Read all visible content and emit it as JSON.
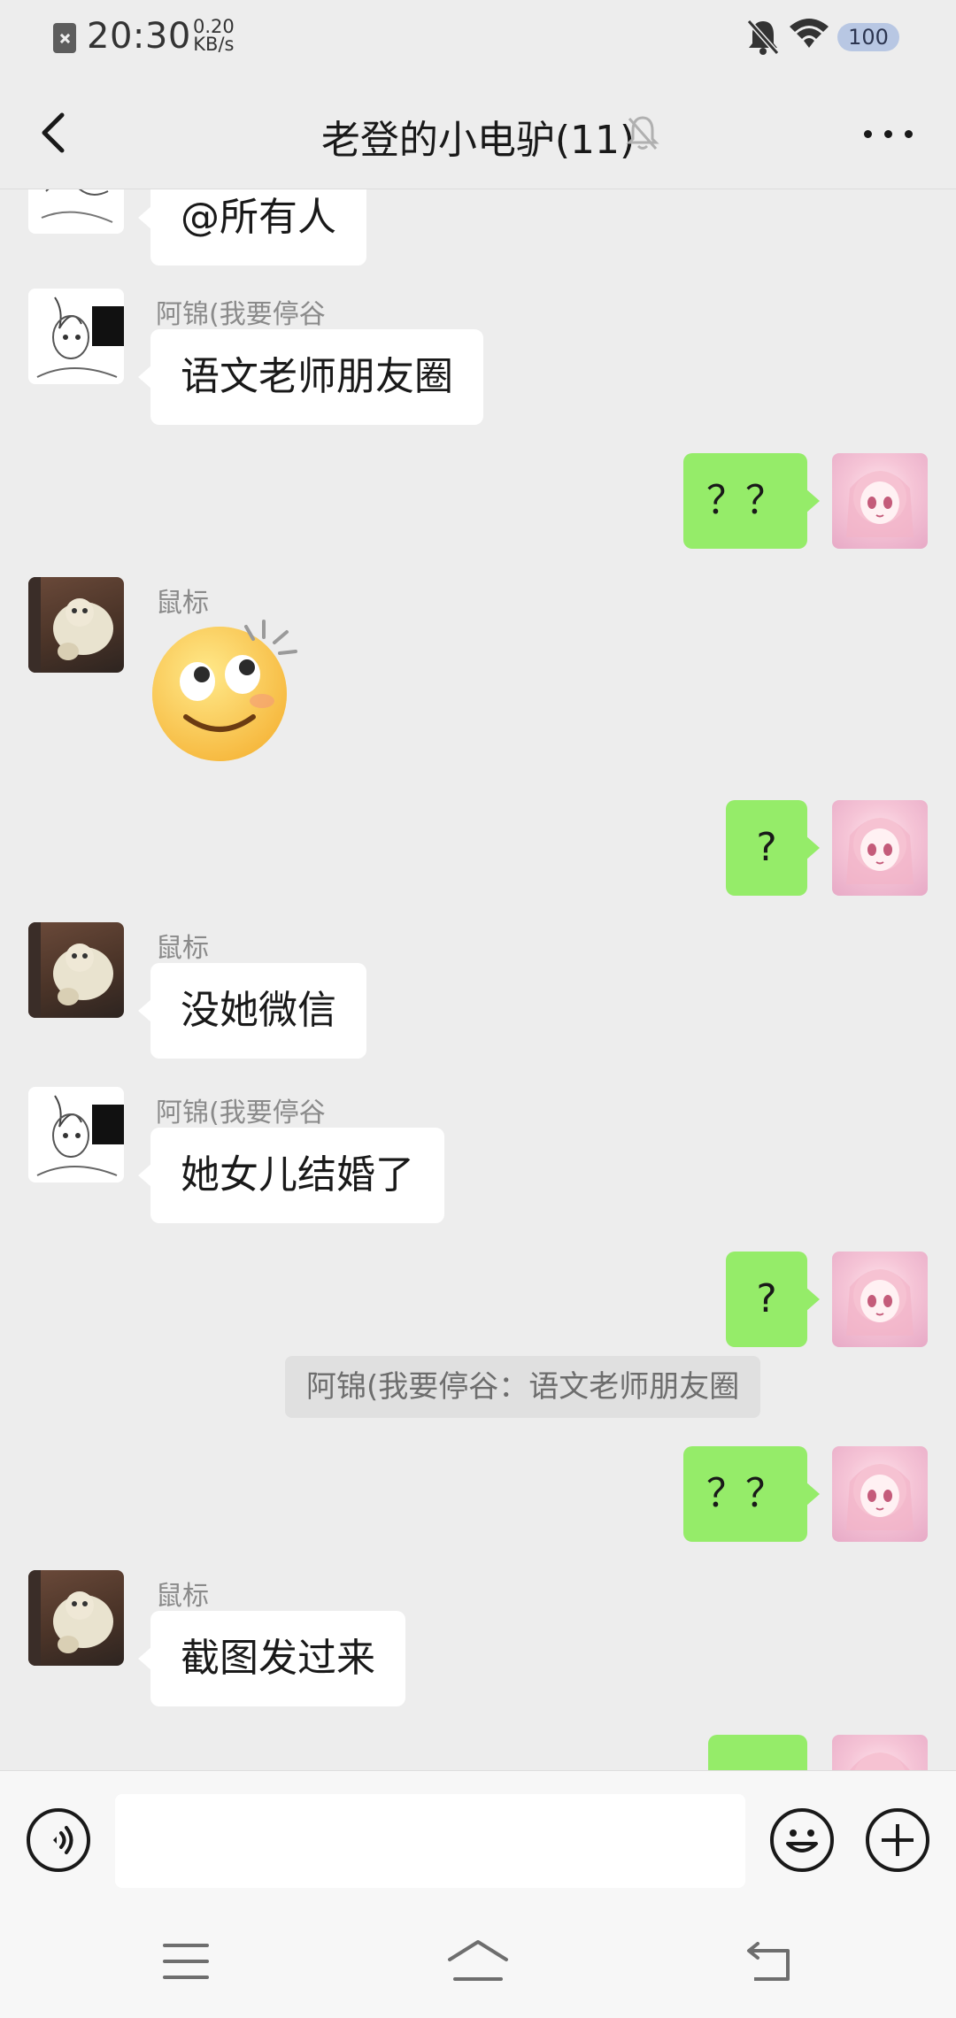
{
  "status_bar": {
    "time": "20:30",
    "speed_value": "0.20",
    "speed_unit": "KB/s",
    "battery": "100",
    "battery_color": "#b8c7e3"
  },
  "header": {
    "title": "老登的小电驴(11)",
    "back_icon": "chevron-left-icon",
    "mute_icon": "bell-off-icon",
    "more_icon": "more-dots-icon"
  },
  "colors": {
    "background": "#ededed",
    "outgoing_bubble": "#95ec69",
    "incoming_bubble": "#ffffff",
    "sender_name": "#8a8a8a"
  },
  "messages": [
    {
      "side": "left",
      "sender": "",
      "text": "@所有人",
      "avatar": "anime-avatar"
    },
    {
      "side": "left",
      "sender": "阿锦(我要停谷",
      "text": "语文老师朋友圈",
      "avatar": "anime-avatar"
    },
    {
      "side": "right",
      "text": "？？",
      "avatar": "pink-avatar"
    },
    {
      "side": "left",
      "sender": "鼠标",
      "type": "emoji",
      "emoji": "🙄",
      "avatar": "cat-avatar"
    },
    {
      "side": "right",
      "text": "?",
      "avatar": "pink-avatar"
    },
    {
      "side": "left",
      "sender": "鼠标",
      "text": "没她微信",
      "avatar": "cat-avatar"
    },
    {
      "side": "left",
      "sender": "阿锦(我要停谷",
      "text": "她女儿结婚了",
      "avatar": "anime-avatar"
    },
    {
      "side": "right",
      "text": "?",
      "avatar": "pink-avatar"
    },
    {
      "side": "right",
      "type": "quote",
      "text": "阿锦(我要停谷：语文老师朋友圈"
    },
    {
      "side": "right",
      "text": "？？",
      "avatar": "pink-avatar"
    },
    {
      "side": "left",
      "sender": "鼠标",
      "text": "截图发过来",
      "avatar": "cat-avatar"
    },
    {
      "side": "right",
      "text": "",
      "avatar": "pink-avatar"
    }
  ],
  "input_bar": {
    "value": "",
    "voice_icon": "voice-icon",
    "emoji_icon": "emoji-icon",
    "plus_icon": "plus-icon"
  },
  "nav_bar": {
    "menu_icon": "menu-icon",
    "home_icon": "home-icon",
    "back_icon": "back-icon"
  }
}
